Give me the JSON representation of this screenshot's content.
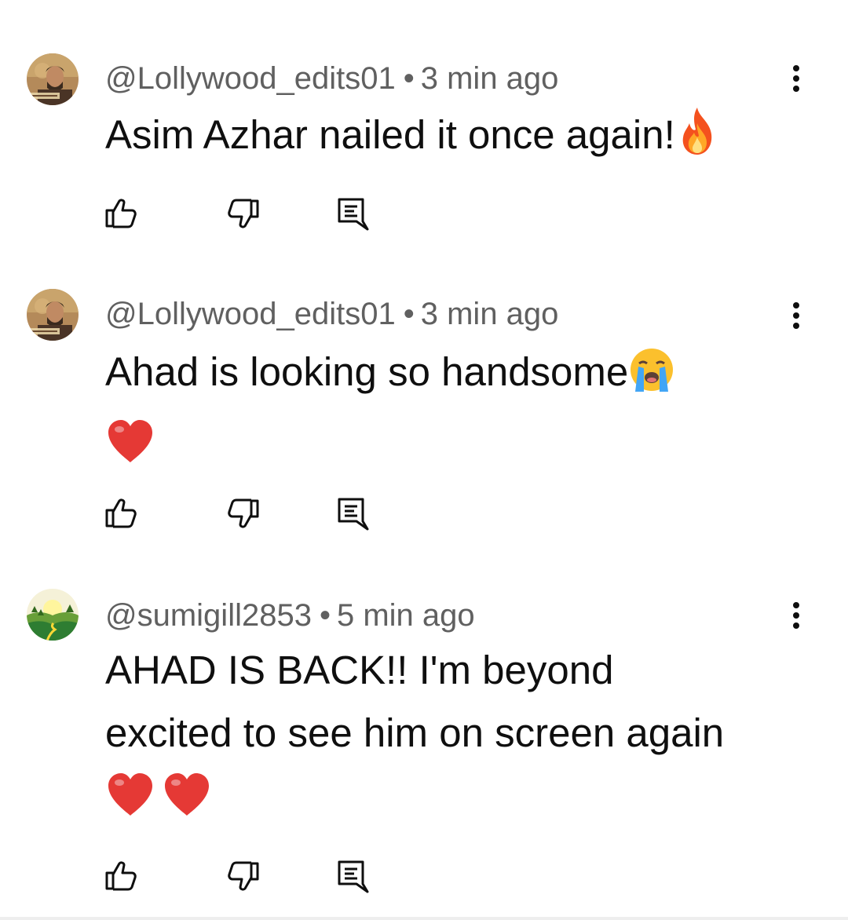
{
  "comments": [
    {
      "handle": "@Lollywood_edits01",
      "separator": "•",
      "time": "3 min ago",
      "text": "Asim Azhar nailed it once again!",
      "emojis": [
        "fire-emoji"
      ],
      "avatar": "avatar-lollywood"
    },
    {
      "handle": "@Lollywood_edits01",
      "separator": "•",
      "time": "3 min ago",
      "text": "Ahad is looking so handsome",
      "emojis": [
        "crying-face-emoji",
        "red-heart-emoji"
      ],
      "avatar": "avatar-lollywood"
    },
    {
      "handle": "@sumigill2853",
      "separator": "•",
      "time": "5 min ago",
      "text_line1": "AHAD IS BACK!! I'm beyond",
      "text_line2": "excited to see him on screen again",
      "emojis": [
        "red-heart-emoji",
        "red-heart-emoji"
      ],
      "avatar": "avatar-landscape"
    }
  ],
  "icons": {
    "like": "thumbs-up-icon",
    "dislike": "thumbs-down-icon",
    "reply": "reply-icon",
    "more": "more-vertical-icon"
  },
  "colors": {
    "text": "#0f0f0f",
    "meta": "#606060",
    "icon": "#0f0f0f"
  }
}
